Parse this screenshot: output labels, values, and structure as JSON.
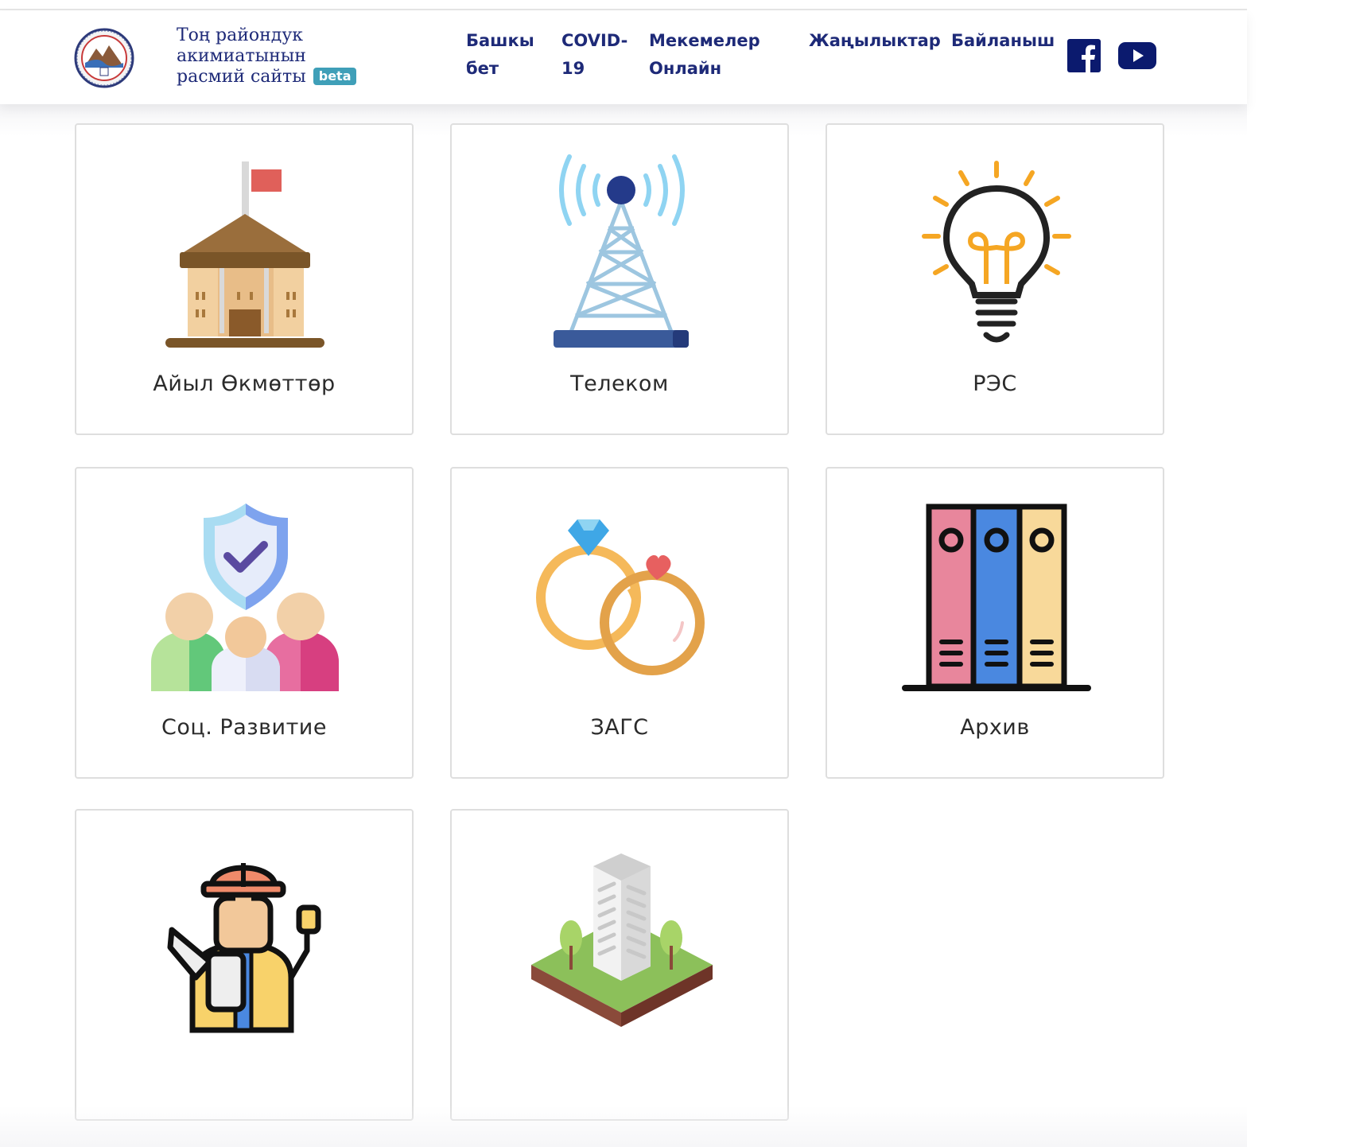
{
  "header": {
    "site_title_line1": "Тоң райондук",
    "site_title_line2": "акимиатынын",
    "site_title_line3": "расмий сайты",
    "badge": "beta",
    "logo_seal": "ТОҢ РАЙОНУ"
  },
  "nav": {
    "home_line1": "Башкы",
    "home_line2": "бет",
    "covid_line1": "COVID-",
    "covid_line2": "19",
    "institutions_line1": "Мекемелер",
    "institutions_line2": "Онлайн",
    "news": "Жаңылыктар",
    "contact": "Байланыш"
  },
  "social": {
    "facebook_icon": "facebook-icon",
    "youtube_icon": "youtube-icon"
  },
  "cards": [
    {
      "label": "Айыл Өкмөттөр",
      "icon": "government-building-icon"
    },
    {
      "label": "Телеком",
      "icon": "radio-tower-icon"
    },
    {
      "label": "РЭС",
      "icon": "lightbulb-icon"
    },
    {
      "label": "Соц. Развитие",
      "icon": "social-protection-icon"
    },
    {
      "label": "ЗАГС",
      "icon": "wedding-rings-icon"
    },
    {
      "label": "Архив",
      "icon": "archive-binders-icon"
    },
    {
      "label": "",
      "icon": "construction-worker-icon"
    },
    {
      "label": "",
      "icon": "building-plot-icon"
    }
  ],
  "colors": {
    "brand_navy": "#1e2a78",
    "beta_badge": "#3f9fb8",
    "card_border": "#dedede"
  }
}
